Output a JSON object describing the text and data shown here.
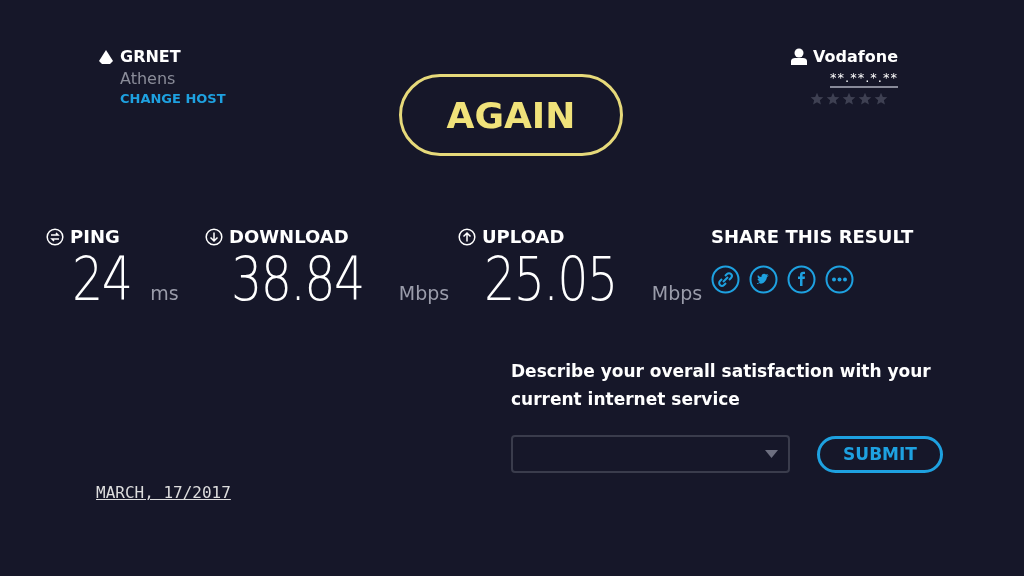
{
  "host": {
    "name": "GRNET",
    "location": "Athens",
    "change_link": "CHANGE HOST"
  },
  "again_button": "AGAIN",
  "isp": {
    "name": "Vodafone",
    "ip": "**.**.*.**",
    "stars": 0
  },
  "metrics": [
    {
      "kind": "ping",
      "label": "PING",
      "value": "24",
      "unit": "ms"
    },
    {
      "kind": "download",
      "label": "DOWNLOAD",
      "value": "38.84",
      "unit": "Mbps"
    },
    {
      "kind": "upload",
      "label": "UPLOAD",
      "value": "25.05",
      "unit": "Mbps"
    }
  ],
  "share": {
    "title": "SHARE THIS RESULT",
    "buttons": [
      {
        "kind": "link"
      },
      {
        "kind": "twitter"
      },
      {
        "kind": "facebook"
      },
      {
        "kind": "more"
      }
    ]
  },
  "survey": {
    "question": "Describe your overall satisfaction with your current internet service",
    "submit": "SUBMIT"
  },
  "date": "MARCH, 17/2017"
}
